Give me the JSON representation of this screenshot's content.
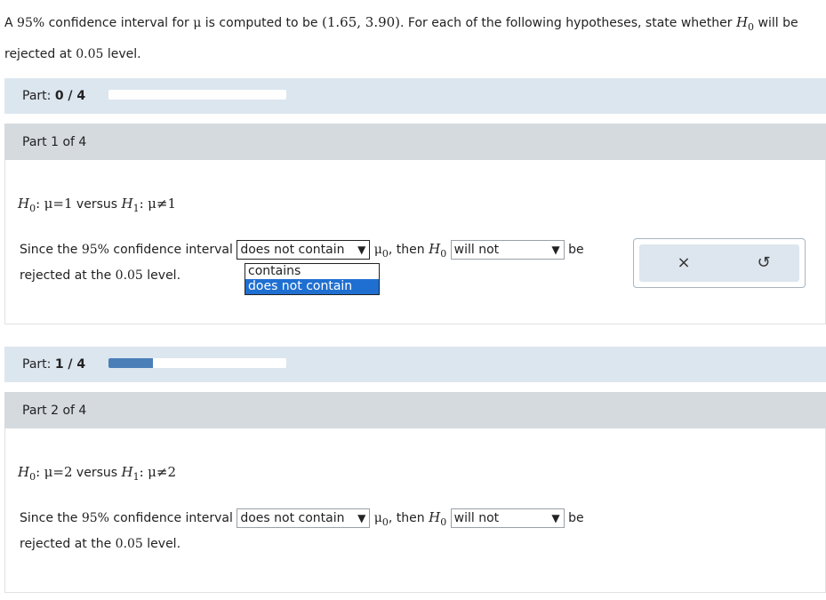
{
  "intro": {
    "text_a": "A ",
    "pct": "95%",
    "text_b": " confidence interval for ",
    "mu": "μ",
    "text_c": " is computed to be ",
    "interval": "(1.65, 3.90)",
    "text_d": ". For each of the following hypotheses, state whether ",
    "h": "H",
    "h_sub": "0",
    "text_e": " will be rejected at ",
    "level": "0.05",
    "text_f": " level."
  },
  "progress": [
    {
      "label": "Part:",
      "value": "0 / 4",
      "fraction": 0.0
    },
    {
      "label": "Part:",
      "value": "1 / 4",
      "fraction": 0.25
    }
  ],
  "parts": [
    {
      "header": "Part 1 of 4",
      "hyp": {
        "h0": "H",
        "h0_sub": "0",
        "colon": ":",
        "mu": "μ",
        "eq": "=",
        "val": "1",
        "versus": " versus ",
        "h1": "H",
        "h1_sub": "1",
        "colon2": ":",
        "mu2": "μ",
        "neq": "≠",
        "val2": "1"
      },
      "sentence_a": "Since the ",
      "pct": "95%",
      "sentence_b": " confidence interval",
      "select1_value": "does not contain",
      "mu0": "μ",
      "mu0_sub": "0",
      "then": ", then ",
      "h": "H",
      "h_sub": "0",
      "select2_value": "will not",
      "be": "be",
      "line2_a": "rejected at the ",
      "level": "0.05",
      "line2_b": " level."
    },
    {
      "header": "Part 2 of 4",
      "hyp": {
        "h0": "H",
        "h0_sub": "0",
        "colon": ":",
        "mu": "μ",
        "eq": "=",
        "val": "2",
        "versus": " versus ",
        "h1": "H",
        "h1_sub": "1",
        "colon2": ":",
        "mu2": "μ",
        "neq": "≠",
        "val2": "2"
      },
      "sentence_a": "Since the ",
      "pct": "95%",
      "sentence_b": " confidence interval",
      "select1_value": "does not contain",
      "mu0": "μ",
      "mu0_sub": "0",
      "then": ", then ",
      "h": "H",
      "h_sub": "0",
      "select2_value": "will not",
      "be": "be",
      "line2_a": "rejected at the ",
      "level": "0.05",
      "line2_b": " level."
    }
  ],
  "dropdown": {
    "options": [
      "contains",
      "does not contain"
    ]
  },
  "tools": {
    "clear_icon": "×",
    "undo_icon": "↺"
  },
  "arrow": "▼"
}
